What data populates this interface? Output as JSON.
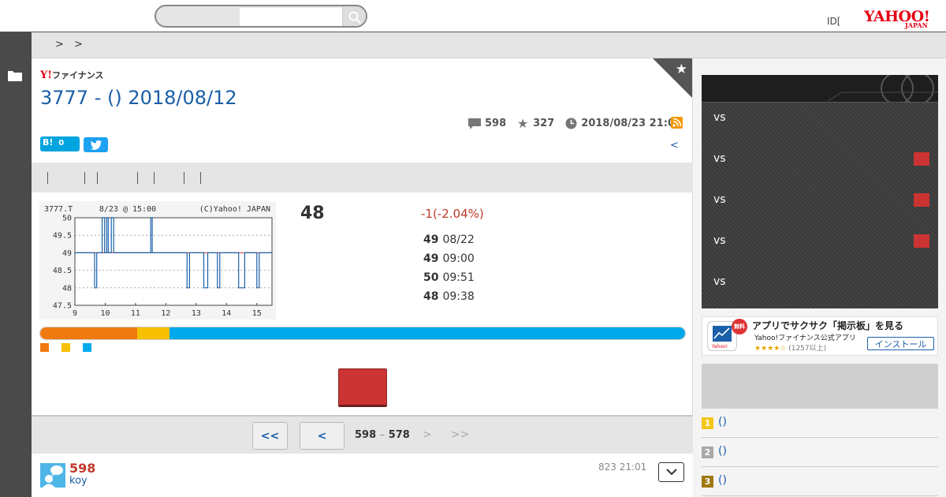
{
  "header": {
    "search_placeholder": "",
    "id_text": "ID[",
    "logo_main": "YAHOO!",
    "logo_sub": "JAPAN"
  },
  "breadcrumb": [
    ">",
    ">"
  ],
  "brand": {
    "mark": "Y!",
    "name": "ファイナンス"
  },
  "title": "3777 - () 2018/08/12",
  "stats": {
    "comments": "598",
    "favorites": "327",
    "datetime": "2018/08/23 21:01"
  },
  "social": {
    "hatena_label": "B!",
    "hatena_count": "0"
  },
  "prev_link": "<",
  "stock": {
    "price": "48",
    "change": "-1(-2.04%)",
    "rows": [
      {
        "value": "49",
        "time": "08/22"
      },
      {
        "value": "49",
        "time": "09:00"
      },
      {
        "value": "50",
        "time": "09:51"
      },
      {
        "value": "48",
        "time": "09:38"
      }
    ]
  },
  "chart_data": {
    "type": "line",
    "title": "",
    "header_left": "3777.T",
    "header_mid": "8/23 @ 15:00",
    "header_right": "(C)Yahoo! JAPAN",
    "xlabel": "",
    "ylabel": "",
    "x_ticks": [
      "9",
      "10",
      "11",
      "12",
      "13",
      "14",
      "15"
    ],
    "y_ticks": [
      "50",
      "49.5",
      "49",
      "48.5",
      "48",
      "47.5"
    ],
    "ylim": [
      47.5,
      50
    ],
    "xlim": [
      9,
      15.5
    ],
    "reference_line": 49,
    "series": [
      {
        "x": [
          9,
          9.65,
          9.65,
          9.68,
          9.68,
          9.72,
          9.72,
          9.9,
          9.9,
          9.98,
          9.98,
          10.05,
          10.05,
          10.1,
          10.1,
          10.2,
          10.2,
          10.28,
          10.28,
          11.5,
          11.5,
          11.55,
          11.55,
          12.7,
          12.7,
          12.78,
          12.78,
          13.25,
          13.25,
          13.38,
          13.38,
          13.7,
          13.7,
          13.78,
          13.78,
          14.4,
          14.4,
          14.6,
          14.6,
          15.0,
          15.0,
          15.08,
          15.08,
          15.5
        ],
        "y": [
          49,
          49,
          48,
          48,
          48,
          48,
          49,
          49,
          50,
          50,
          49,
          49,
          50,
          50,
          49,
          49,
          50,
          50,
          49,
          49,
          50,
          50,
          49,
          49,
          48,
          48,
          49,
          49,
          48,
          48,
          49,
          49,
          48,
          48,
          49,
          49,
          48,
          48,
          49,
          49,
          48,
          48,
          49,
          49
        ]
      }
    ]
  },
  "sentiment": {
    "segments": [
      {
        "share": 0.15,
        "color": "#f07a10"
      },
      {
        "share": 0.05,
        "color": "#f7c000"
      },
      {
        "share": 0.8,
        "color": "#00a9ec"
      }
    ]
  },
  "pager": {
    "first": "<<",
    "prev": "<",
    "range_start": "598",
    "range_sep": "–",
    "range_end": "578",
    "next": ">",
    "last": ">>"
  },
  "post": {
    "number": "598",
    "user": "koy",
    "date": "823 21:01"
  },
  "sidebar": {
    "games": [
      {
        "label": "vs",
        "marked": false
      },
      {
        "label": "vs",
        "marked": true
      },
      {
        "label": "vs",
        "marked": true
      },
      {
        "label": "vs",
        "marked": true
      },
      {
        "label": "vs",
        "marked": false
      }
    ],
    "banner": {
      "badge": "無料",
      "title": "アプリでサクサク「掲示板」を見る",
      "subtitle": "Yahoo!ファイナンス公式アプリ",
      "stars": "★★★★☆",
      "reviews": "(1257以上)",
      "install": "インストール"
    },
    "ranking": [
      {
        "rank": "1",
        "text": "()",
        "color": "#f5c518"
      },
      {
        "rank": "2",
        "text": "()",
        "color": "#a9a9a9"
      },
      {
        "rank": "3",
        "text": "()",
        "color": "#a07a10"
      }
    ]
  }
}
